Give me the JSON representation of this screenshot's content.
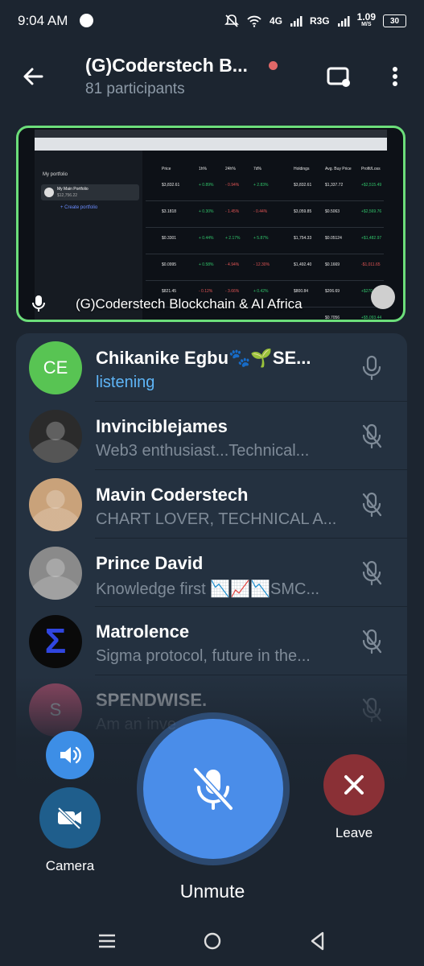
{
  "status_bar": {
    "time": "9:04 AM",
    "network": "4G",
    "network2": "R3G",
    "speed": "1.09",
    "speed_unit": "M/S",
    "battery": "30"
  },
  "header": {
    "title": "(G)Coderstech B...",
    "subtitle": "81 participants"
  },
  "screen_share": {
    "label": "(G)Coderstech Blockchain & AI Africa",
    "portfolio_title": "My portfolio",
    "portfolio_name": "My Main Portfolio",
    "portfolio_value": "$12,756.22",
    "create_link": "+ Create portfolio",
    "columns": [
      "Price",
      "1h%",
      "24h%",
      "7d%",
      "Holdings",
      "Avg. Buy Price",
      "Profit/Loss"
    ],
    "rows": [
      [
        "$3,832.61",
        "+ 0.89%",
        "- 0.94%",
        "+ 2.83%",
        "$3,832.61",
        "$1,337.72",
        "+$2,515.49"
      ],
      [
        "$3.1818",
        "+ 0.30%",
        "- 1.45%",
        "- 0.44%",
        "$3,059.85",
        "$0.5063",
        "+$2,569.76"
      ],
      [
        "$0.3301",
        "+ 0.44%",
        "+ 2.17%",
        "+ 5.87%",
        "$1,754.33",
        "$0.05124",
        "+$1,482.97"
      ],
      [
        "$0.0995",
        "+ 0.58%",
        "- 4.94%",
        "- 12.30%",
        "$1,492.40",
        "$0.1669",
        "-$1,011.65"
      ],
      [
        "$821.45",
        "- 0.12%",
        "- 3.66%",
        "+ 0.42%",
        "$800.84",
        "$206.69",
        "+$270.70"
      ],
      [
        "",
        "",
        "",
        "",
        "",
        "$0.7056",
        "+$5,093.44"
      ]
    ]
  },
  "participants": [
    {
      "initials": "CE",
      "name": "Chikanike Egbu🐾🌱SE...",
      "status": "listening",
      "avatar_color": "#58c453",
      "listening": true
    },
    {
      "initials": "",
      "name": "Invinciblejames",
      "status": "Web3 enthusiast...Technical...",
      "avatar_color": "#2b2b2b"
    },
    {
      "initials": "",
      "name": "Mavin Coderstech",
      "status": "CHART LOVER, TECHNICAL A...",
      "avatar_color": "#c9a27a"
    },
    {
      "initials": "",
      "name": "Prince David",
      "status": "Knowledge first 📉📈📉SMC...",
      "avatar_color": "#8a8a8a"
    },
    {
      "initials": "Σ",
      "name": "Matrolence",
      "status": "Sigma protocol, future in the...",
      "avatar_color": "#0a0a0a"
    },
    {
      "initials": "S",
      "name": "SPENDWISE.",
      "status": "Am an inve...",
      "avatar_color": "#e05a7c"
    }
  ],
  "controls": {
    "camera_label": "Camera",
    "unmute_label": "Unmute",
    "leave_label": "Leave"
  },
  "colors": {
    "background": "#1c2530",
    "list_bg": "#243140",
    "accent_blue": "#4a8de9",
    "listening_blue": "#5eb5f7",
    "leave_red": "#8a3036",
    "share_border": "#6cde7a"
  }
}
